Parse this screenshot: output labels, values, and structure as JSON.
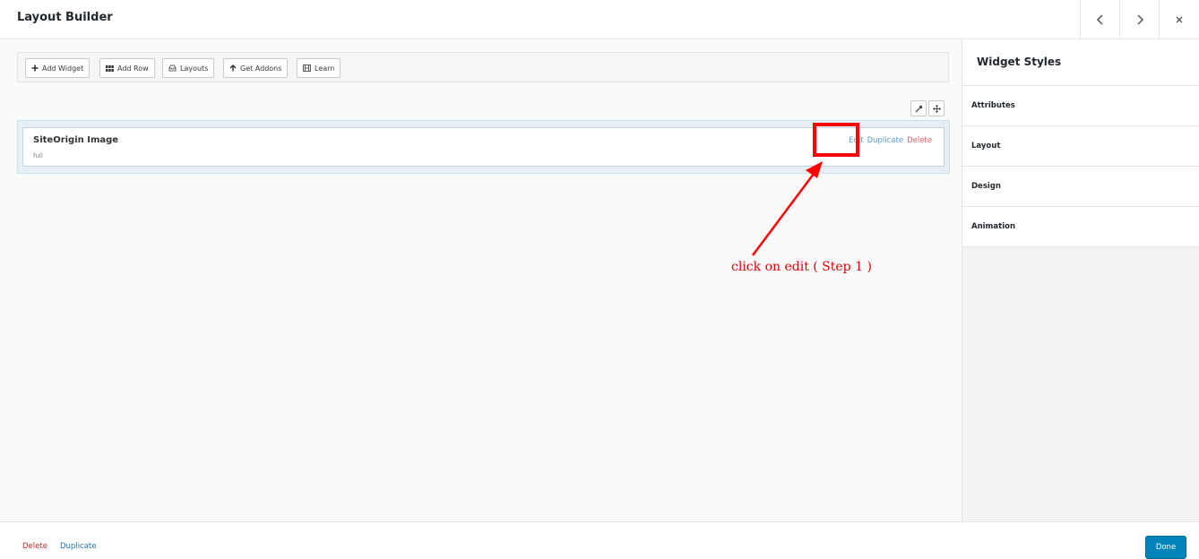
{
  "header": {
    "title": "Layout Builder"
  },
  "toolbar": {
    "add_widget": "Add Widget",
    "add_row": "Add Row",
    "layouts": "Layouts",
    "get_addons": "Get Addons",
    "learn": "Learn"
  },
  "widget": {
    "title": "SiteOrigin Image",
    "description": "full",
    "edit": "Edit",
    "duplicate": "Duplicate",
    "delete": "Delete"
  },
  "sidebar": {
    "title": "Widget Styles",
    "items": [
      "Attributes",
      "Layout",
      "Design",
      "Animation"
    ]
  },
  "footer": {
    "delete": "Delete",
    "duplicate": "Duplicate",
    "done": "Done"
  },
  "annotation": {
    "text": "click on edit ( Step 1 )",
    "color": "#ff0000"
  }
}
